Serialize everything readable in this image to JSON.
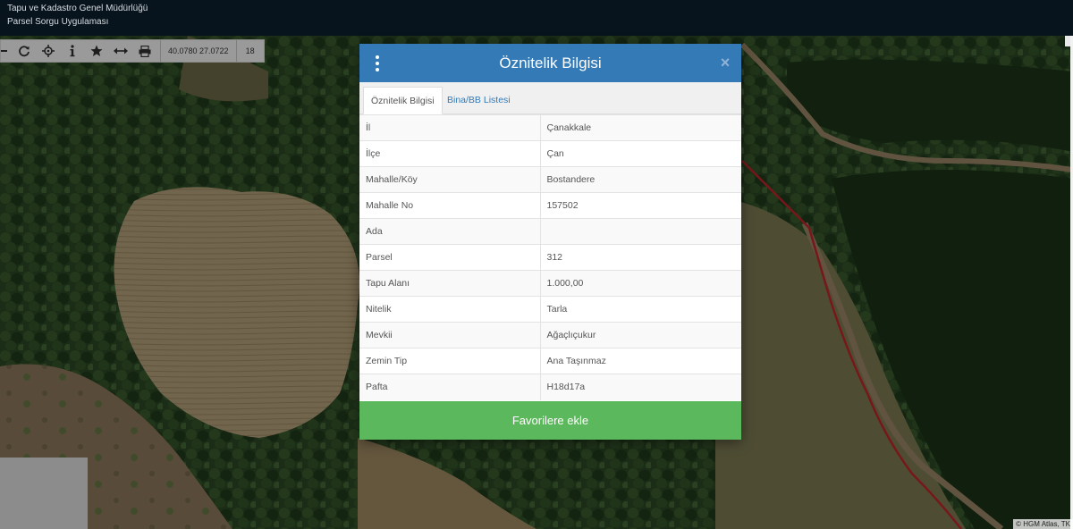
{
  "header": {
    "org_name": "Tapu ve Kadastro Genel Müdürlüğü",
    "app_name": "Parsel Sorgu Uygulaması"
  },
  "toolbar": {
    "coordinates": "40.0780   27.0722",
    "zoom": "18",
    "buttons": [
      {
        "icon": "minus-icon"
      },
      {
        "icon": "refresh-icon"
      },
      {
        "icon": "locate-crosshair-icon"
      },
      {
        "icon": "info-icon"
      },
      {
        "icon": "star-icon"
      },
      {
        "icon": "measure-arrows-icon"
      },
      {
        "icon": "print-icon"
      }
    ]
  },
  "modal": {
    "title": "Öznitelik Bilgisi",
    "close_label": "×",
    "tabs": [
      {
        "label": "Öznitelik Bilgisi",
        "active": true
      },
      {
        "label": "Bina/BB Listesi",
        "active": false
      }
    ],
    "rows": [
      {
        "key": "İl",
        "value": "Çanakkale"
      },
      {
        "key": "İlçe",
        "value": "Çan"
      },
      {
        "key": "Mahalle/Köy",
        "value": "Bostandere"
      },
      {
        "key": "Mahalle No",
        "value": "157502"
      },
      {
        "key": "Ada",
        "value": ""
      },
      {
        "key": "Parsel",
        "value": "312"
      },
      {
        "key": "Tapu Alanı",
        "value": "1.000,00"
      },
      {
        "key": "Nitelik",
        "value": "Tarla"
      },
      {
        "key": "Mevkii",
        "value": "Ağaçlıçukur"
      },
      {
        "key": "Zemin Tip",
        "value": "Ana Taşınmaz"
      },
      {
        "key": "Pafta",
        "value": "H18d17a"
      }
    ],
    "favorite_button": "Favorilere ekle"
  },
  "map": {
    "attribution": "© HGM Atlas, TK"
  },
  "colors": {
    "header_bg": "#07141d",
    "modal_header": "#337ab7",
    "favorite_button": "#5cb85c",
    "parcel_line": "#c0262a"
  }
}
